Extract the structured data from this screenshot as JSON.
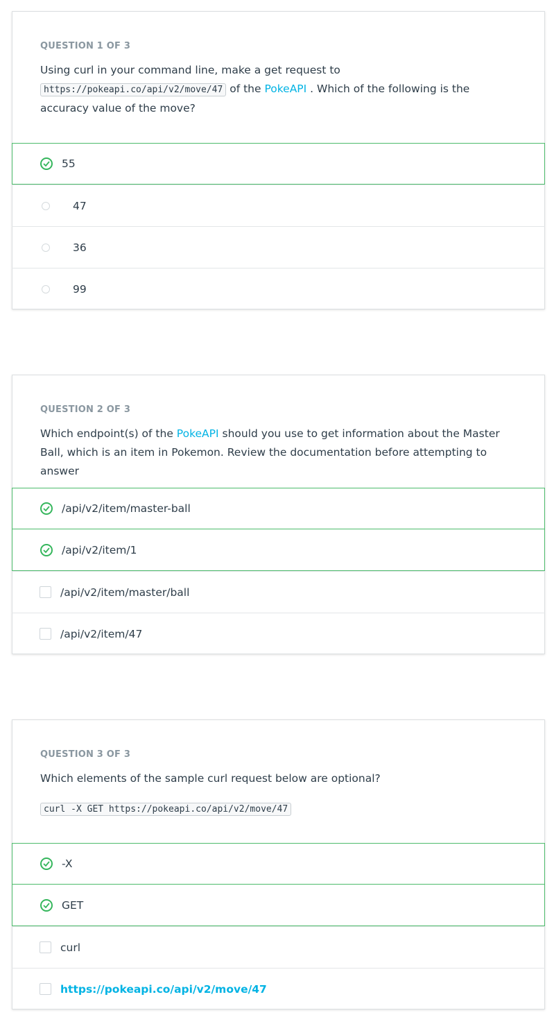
{
  "q1": {
    "label": "QUESTION 1 OF 3",
    "text_before": "Using curl in your command line, make a get request to",
    "code": "https://pokeapi.co/api/v2/move/47",
    "text_mid": "of the",
    "link": "PokeAPI",
    "text_after": ". Which of the following is the accuracy value of the move?",
    "options": [
      {
        "label": "55",
        "selected": true
      },
      {
        "label": "47",
        "selected": false
      },
      {
        "label": "36",
        "selected": false
      },
      {
        "label": "99",
        "selected": false
      }
    ]
  },
  "q2": {
    "label": "QUESTION 2 OF 3",
    "text_before": "Which endpoint(s) of the",
    "link": "PokeAPI",
    "text_after": "should you use to get information about the Master Ball, which is an item in Pokemon. Review the documentation before attempting to answer",
    "options": [
      {
        "label": "/api/v2/item/master-ball",
        "selected": true
      },
      {
        "label": "/api/v2/item/1",
        "selected": true
      },
      {
        "label": "/api/v2/item/master/ball",
        "selected": false
      },
      {
        "label": "/api/v2/item/47",
        "selected": false
      }
    ]
  },
  "q3": {
    "label": "QUESTION 3 OF 3",
    "text": "Which elements of the sample curl request below are optional?",
    "code": "curl -X GET https://pokeapi.co/api/v2/move/47",
    "options": [
      {
        "label": "-X",
        "selected": true
      },
      {
        "label": "GET",
        "selected": true
      },
      {
        "label": "curl",
        "selected": false
      },
      {
        "label": "https://pokeapi.co/api/v2/move/47",
        "selected": false
      }
    ]
  },
  "colors": {
    "accent_link": "#02b3e4",
    "correct_green": "#35b65c",
    "text": "#2e3d49",
    "label_gray": "#8a97a0"
  }
}
